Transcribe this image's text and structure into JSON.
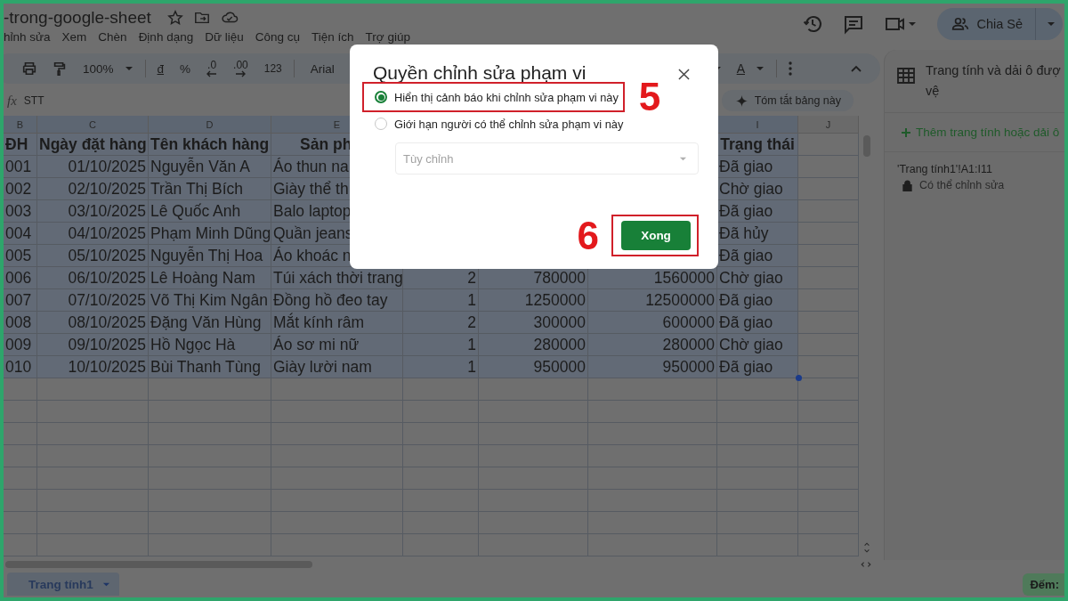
{
  "document": {
    "title": "-trong-google-sheet"
  },
  "menu": [
    "hỉnh sửa",
    "Xem",
    "Chèn",
    "Định dạng",
    "Dữ liệu",
    "Công cụ",
    "Tiện ích",
    "Trợ giúp"
  ],
  "share_button": {
    "label": "Chia Sẻ"
  },
  "toolbar": {
    "zoom": "100%",
    "currency": "đ",
    "percent": "%",
    "decrease_decimal": ".0",
    "increase_decimal": ".00",
    "number_format": "123",
    "font": "Arial",
    "text_color": "A"
  },
  "formula_bar": {
    "fx_label": "fx",
    "value": "STT"
  },
  "summarize_button": {
    "label": "Tóm tắt bảng này"
  },
  "table": {
    "column_letters": [
      "B",
      "C",
      "D",
      "E",
      "I",
      "J"
    ],
    "header_row": {
      "selected": true,
      "cells": [
        "ĐH",
        "Ngày đặt hàng",
        "Tên khách hàng",
        "Sản ph",
        null,
        null,
        null,
        "Trạng thái"
      ]
    },
    "rows": [
      {
        "selected": true,
        "cells": [
          "001",
          "01/10/2025",
          "Nguyễn Văn A",
          "Áo thun na",
          null,
          null,
          null,
          "Đã giao"
        ]
      },
      {
        "selected": true,
        "cells": [
          "002",
          "02/10/2025",
          "Trần Thị Bích",
          "Giày thể th",
          null,
          null,
          null,
          "Chờ giao"
        ]
      },
      {
        "selected": true,
        "cells": [
          "003",
          "03/10/2025",
          "Lê Quốc Anh",
          "Balo laptop",
          null,
          null,
          null,
          "Đã giao"
        ]
      },
      {
        "selected": true,
        "cells": [
          "004",
          "04/10/2025",
          "Phạm Minh Dũng",
          "Quần jeans",
          null,
          null,
          null,
          "Đã hủy"
        ]
      },
      {
        "selected": true,
        "cells": [
          "005",
          "05/10/2025",
          "Nguyễn Thị Hoa",
          "Áo khoác n",
          null,
          null,
          null,
          "Đã giao"
        ]
      },
      {
        "selected": true,
        "cells": [
          "006",
          "06/10/2025",
          "Lê Hoàng Nam",
          "Túi xách thời trang",
          "2",
          "780000",
          "1560000",
          "Chờ giao"
        ]
      },
      {
        "selected": true,
        "cells": [
          "007",
          "07/10/2025",
          "Võ Thị Kim Ngân",
          "Đồng hồ đeo tay",
          "1",
          "1250000",
          "12500000",
          "Đã giao"
        ]
      },
      {
        "selected": true,
        "cells": [
          "008",
          "08/10/2025",
          "Đặng Văn Hùng",
          "Mắt kính râm",
          "2",
          "300000",
          "600000",
          "Đã giao"
        ]
      },
      {
        "selected": true,
        "cells": [
          "009",
          "09/10/2025",
          "Hồ Ngọc Hà",
          "Áo sơ mi nữ",
          "1",
          "280000",
          "280000",
          "Chờ giao"
        ]
      },
      {
        "selected": true,
        "cells": [
          "010",
          "10/10/2025",
          "Bùi Thanh Tùng",
          "Giày lười nam",
          "1",
          "950000",
          "950000",
          "Đã giao"
        ]
      }
    ]
  },
  "sheet_tabs": [
    {
      "label": "Trang tính1",
      "selected": true
    }
  ],
  "status_chip": {
    "label": "Đếm:"
  },
  "side_panel": {
    "title_lines": [
      "Trang tính và dải ô đượ",
      "vệ"
    ],
    "add_link": "Thêm trang tính hoặc dải ô",
    "ranges": [
      {
        "range": "'Trang tính1'!A1:I11",
        "permission": "Có thể chỉnh sửa"
      }
    ]
  },
  "dialog": {
    "title": "Quyền chỉnh sửa phạm vi",
    "options": [
      {
        "label": "Hiển thị cảnh báo khi chỉnh sửa phạm vi này",
        "selected": true,
        "highlighted": true,
        "step": "5"
      },
      {
        "label": "Giới hạn người có thể chỉnh sửa phạm vi này",
        "selected": false,
        "highlighted": false
      }
    ],
    "select": {
      "placeholder": "Tùy chỉnh",
      "disabled": true
    },
    "done_button": {
      "label": "Xong",
      "highlighted": true,
      "step": "6"
    }
  }
}
